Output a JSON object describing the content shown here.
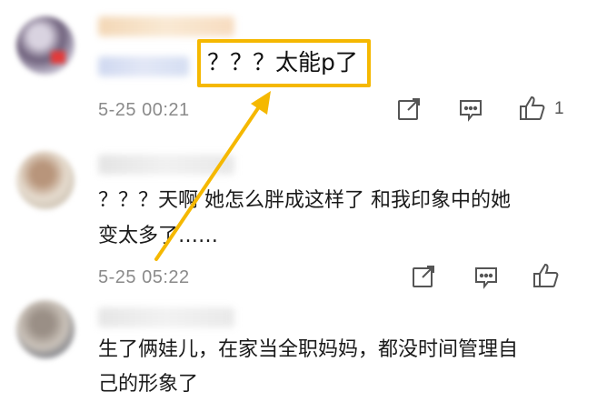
{
  "comments": [
    {
      "avatar_icon": "avatar-icon",
      "text": "？？？太能p了",
      "time": "5-25 00:21",
      "like_count": "1"
    },
    {
      "avatar_icon": "avatar-icon",
      "text_line1": "？？？天啊  她怎么胖成这样了  和我印象中的她",
      "text_line2": "变太多了……",
      "time": "5-25 05:22",
      "like_count": ""
    },
    {
      "avatar_icon": "avatar-icon",
      "text_line1": "生了俩娃儿，在家当全职妈妈，都没时间管理自",
      "text_line2": "己的形象了"
    }
  ],
  "actions": {
    "share_icon": "share-icon",
    "reply_icon": "comment-icon",
    "like_icon": "thumbs-up-icon"
  },
  "highlight": {
    "color": "#f5b800"
  }
}
